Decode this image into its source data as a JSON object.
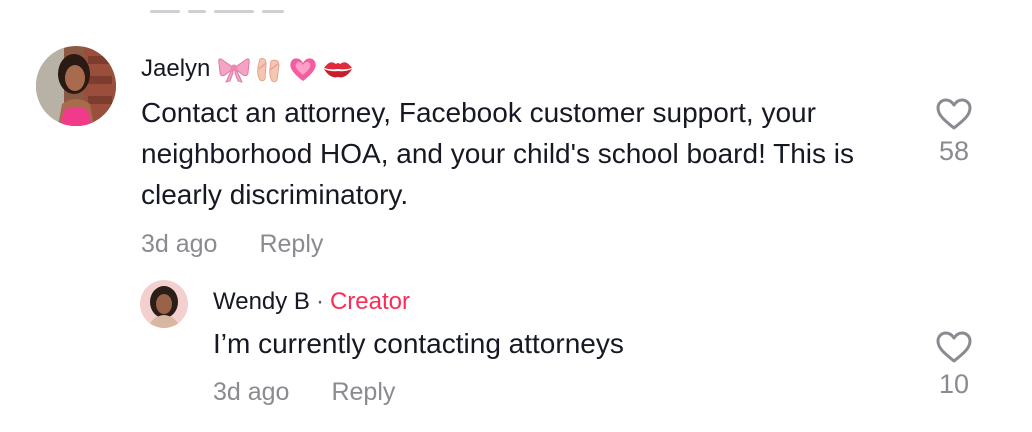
{
  "comments": [
    {
      "username": "Jaelyn",
      "emojis": [
        "bow-emoji",
        "ballet-shoes-emoji",
        "growing-heart-emoji",
        "kiss-mark-emoji"
      ],
      "text": "Contact an attorney, Facebook customer support, your neighborhood HOA, and your child's school board! This is clearly discriminatory.",
      "time": "3d ago",
      "reply_label": "Reply",
      "likes": "58",
      "like_icon": "heart-outline-icon"
    }
  ],
  "reply": {
    "username": "Wendy B",
    "separator": "·",
    "badge": "Creator",
    "text": "I’m currently contacting attorneys",
    "time": "3d ago",
    "reply_label": "Reply",
    "likes": "10",
    "like_icon": "heart-outline-icon"
  },
  "colors": {
    "text": "#161823",
    "muted": "#8a8b91",
    "creator_badge": "#fe2c55"
  }
}
